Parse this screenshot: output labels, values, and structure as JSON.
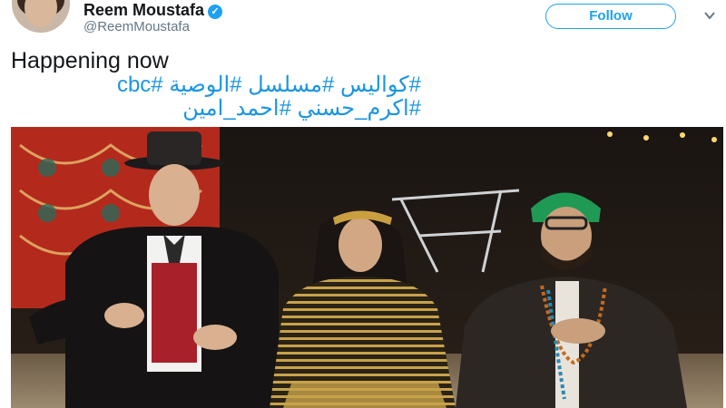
{
  "tweet": {
    "author_name": "Reem Moustafa",
    "author_handle": "@ReemMoustafa",
    "follow_label": "Follow",
    "text": "Happening now",
    "hashtags_line1": "#كواليس #مسلسل #الوصية #cbc",
    "hashtags_line2": "#اكرم_حسني #احمد_امين"
  },
  "icons": {
    "verified": "verified-badge-icon",
    "menu": "chevron-down-icon"
  },
  "colors": {
    "accent": "#1da1f2",
    "name": "#14171a",
    "handle": "#657786",
    "hashtag": "#1b95e0"
  }
}
